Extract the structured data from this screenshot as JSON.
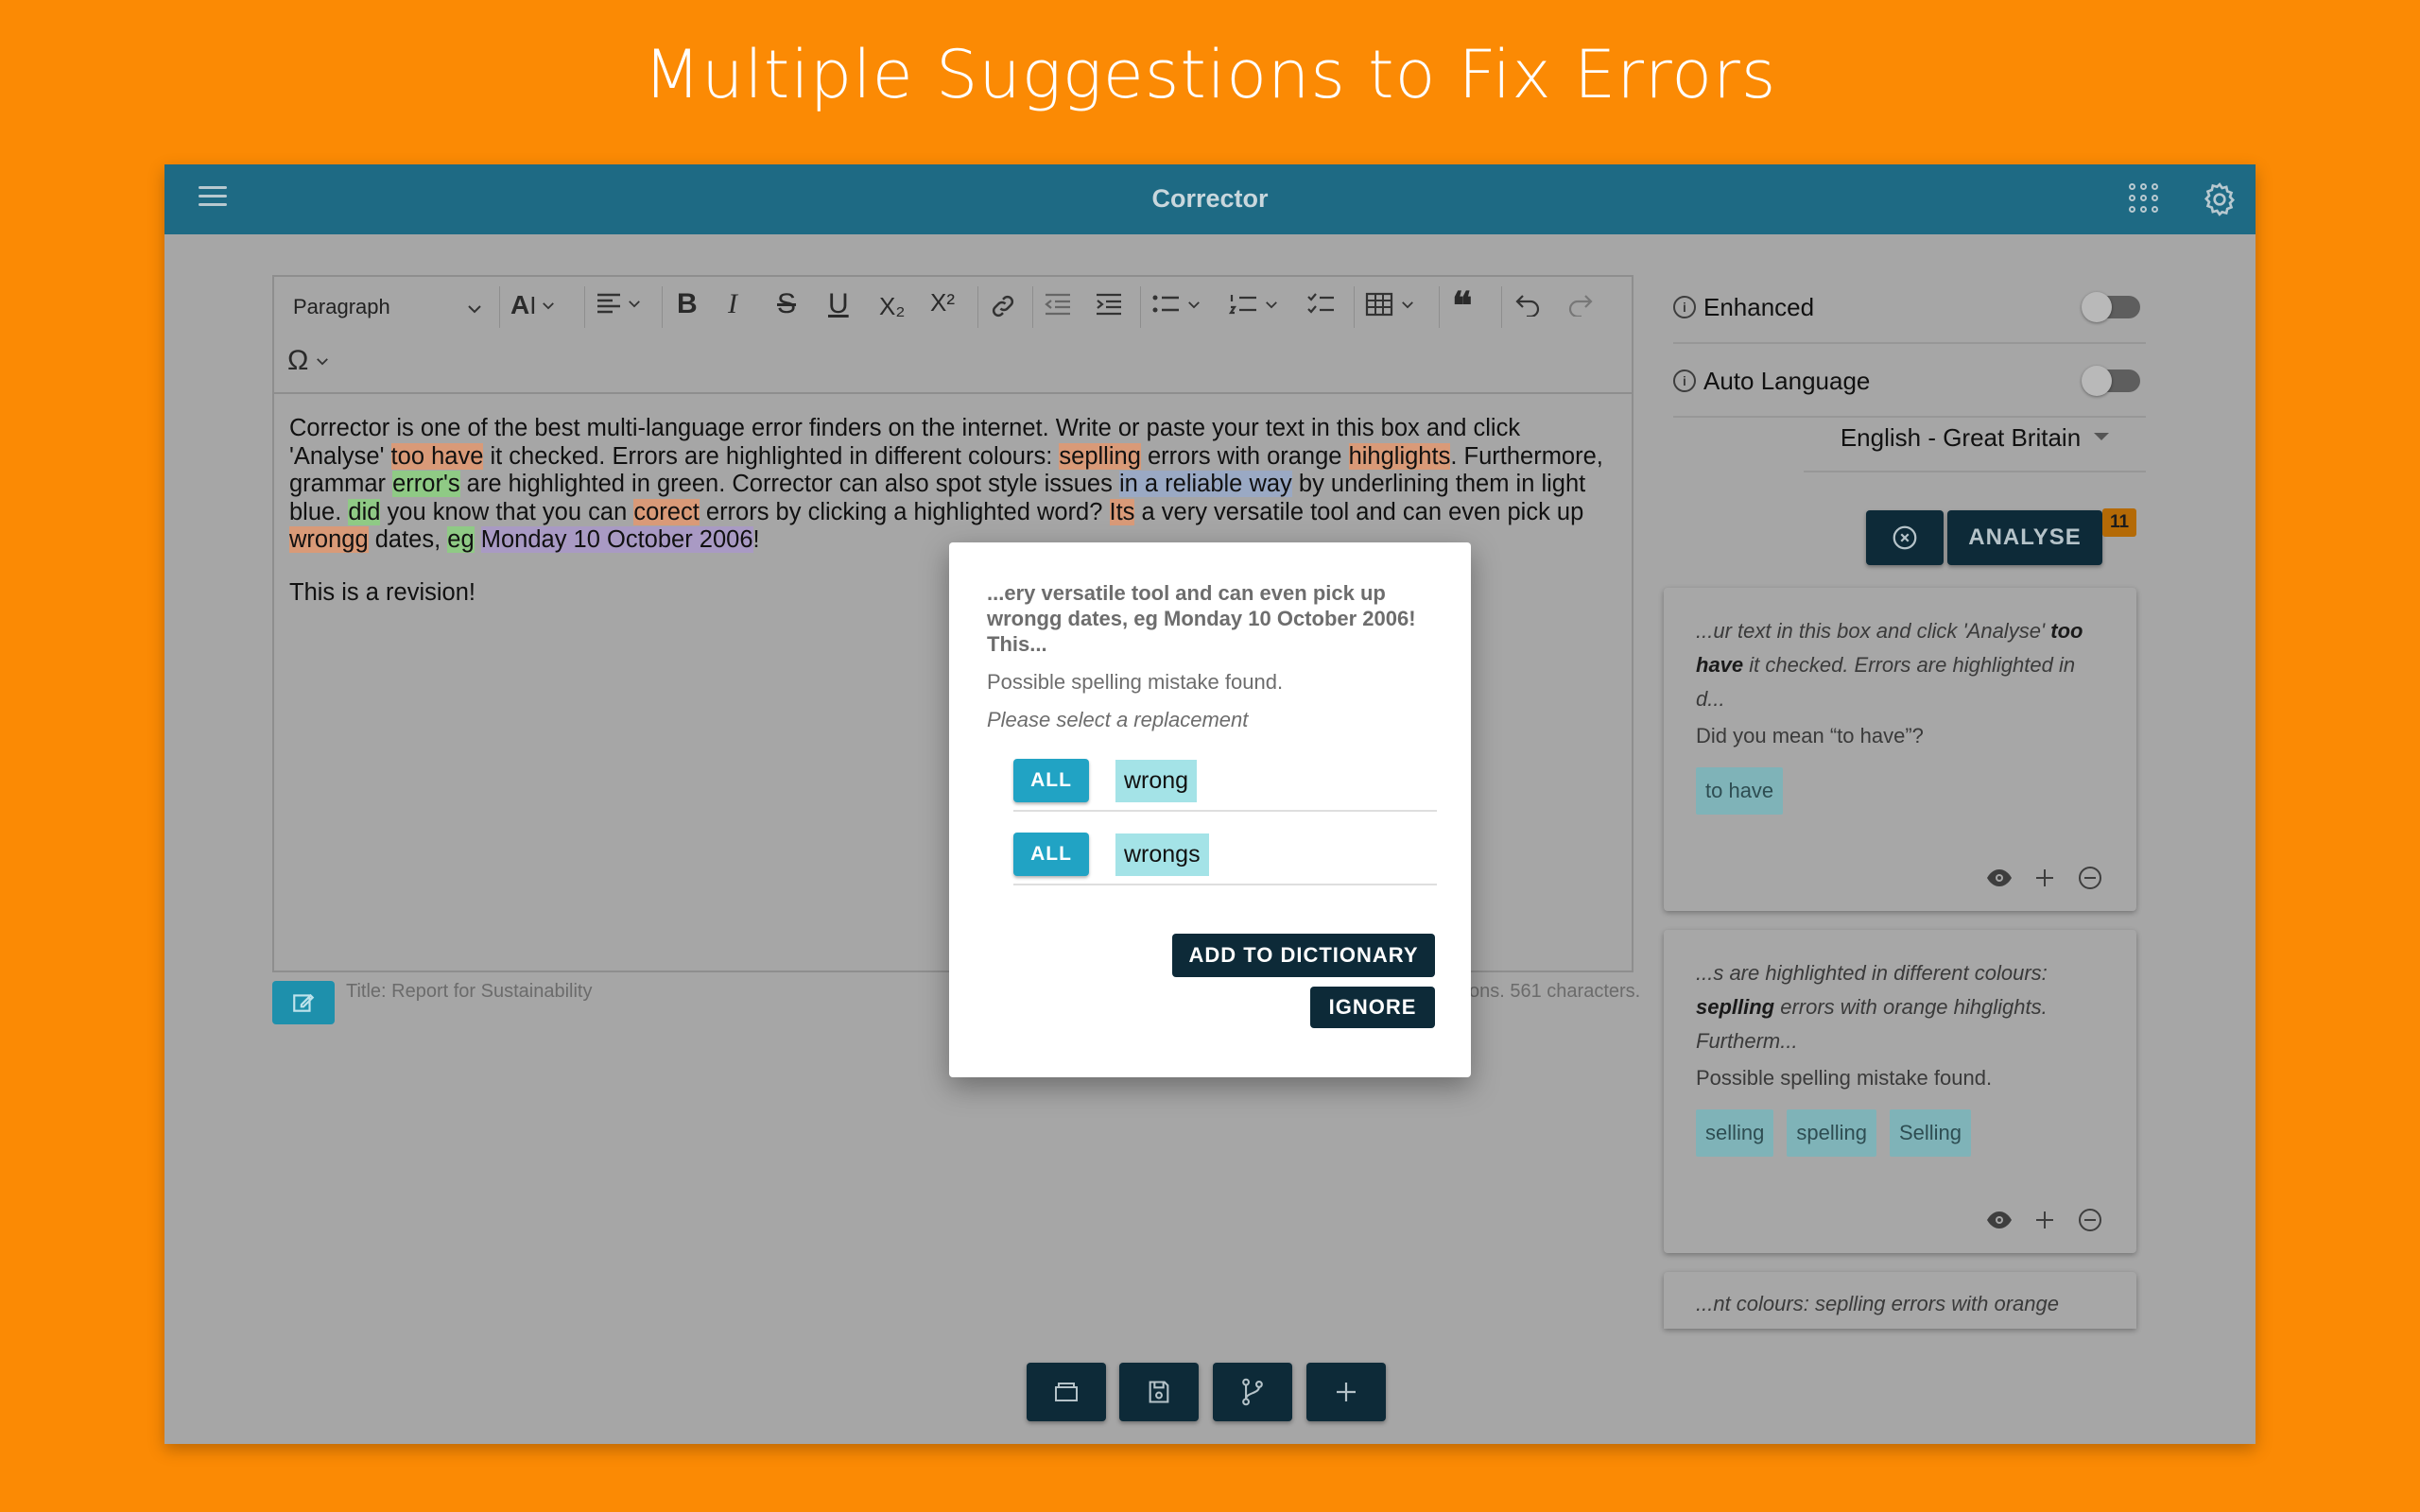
{
  "banner": {
    "title": "Multiple Suggestions to Fix Errors"
  },
  "appbar": {
    "title": "Corrector",
    "menu_icon": "hamburger-icon",
    "apps_icon": "grid-icon",
    "settings_icon": "gear-icon"
  },
  "toolbar": {
    "paragraph_label": "Paragraph",
    "bold": "B",
    "italic": "I",
    "strike": "S",
    "underline": "U",
    "subscript": "X₂",
    "superscript": "X²",
    "special_char": "Ω",
    "quote": "❝"
  },
  "editor": {
    "p1": [
      {
        "t": "Corrector is one of the best multi-language error finders on the internet. Write or paste your text in this box and click 'Analyse' ",
        "h": ""
      },
      {
        "t": "too have",
        "h": "o"
      },
      {
        "t": " it checked. Errors are highlighted in different colours: ",
        "h": ""
      },
      {
        "t": "seplling",
        "h": "o"
      },
      {
        "t": " errors with orange ",
        "h": ""
      },
      {
        "t": "hihglights",
        "h": "o"
      },
      {
        "t": ". Furthermore, grammar ",
        "h": ""
      },
      {
        "t": "error's",
        "h": "g"
      },
      {
        "t": " are highlighted in green. Corrector can also spot style issues ",
        "h": ""
      },
      {
        "t": "in a reliable way",
        "h": "b"
      },
      {
        "t": " by underlining them in light blue. ",
        "h": ""
      },
      {
        "t": "did",
        "h": "g"
      },
      {
        "t": " you know that you can ",
        "h": ""
      },
      {
        "t": "corect",
        "h": "o"
      },
      {
        "t": " errors by clicking a highlighted word? ",
        "h": ""
      },
      {
        "t": "Its",
        "h": "o"
      },
      {
        "t": " a very versatile tool and can even pick up ",
        "h": ""
      },
      {
        "t": "wrongg",
        "h": "o"
      },
      {
        "t": " dates, ",
        "h": ""
      },
      {
        "t": "eg",
        "h": "g"
      },
      {
        "t": " ",
        "h": ""
      },
      {
        "t": "Monday 10 October 2006",
        "h": "p"
      },
      {
        "t": "!",
        "h": ""
      }
    ],
    "p2": "This is a revision!",
    "title_label": "Title: Report for Sustainability",
    "count_label": "ons. 561 characters."
  },
  "panel": {
    "enhanced_label": "Enhanced",
    "auto_language_label": "Auto Language",
    "language": "English - Great Britain",
    "analyse_label": "ANALYSE",
    "error_count": "11",
    "cards": [
      {
        "ctx_pre": "...ur text in this box and click 'Analyse' ",
        "ctx_bold": "too have",
        "ctx_post": " it checked. Errors are highlighted in d...",
        "message": "Did you mean “to have”?",
        "suggestions": [
          "to have"
        ]
      },
      {
        "ctx_pre": "...s are highlighted in different colours: ",
        "ctx_bold": "seplling",
        "ctx_post": " errors with orange hihglights. Furtherm...",
        "message": "Possible spelling mistake found.",
        "suggestions": [
          "selling",
          "spelling",
          "Selling"
        ]
      },
      {
        "ctx_pre": "...nt colours: seplling errors with orange",
        "ctx_bold": "",
        "ctx_post": "",
        "message": "",
        "suggestions": []
      }
    ]
  },
  "dialog": {
    "context": "...ery versatile tool and can even pick up wrongg dates, eg Monday 10 October 2006! This...",
    "message": "Possible spelling mistake found.",
    "prompt": "Please select a replacement",
    "all_label": "ALL",
    "replacements": [
      "wrong",
      "wrongs"
    ],
    "add_to_dictionary": "ADD TO DICTIONARY",
    "ignore": "IGNORE"
  },
  "colors": {
    "background": "#fb8a04",
    "appbar": "#1e6a84",
    "primary_dark": "#0d2a38",
    "accent": "#21a3c4",
    "highlight_orange": "#d99a78",
    "highlight_green": "#8fca85",
    "highlight_blue": "#9aa9c4",
    "highlight_purple": "#a99ac4"
  }
}
